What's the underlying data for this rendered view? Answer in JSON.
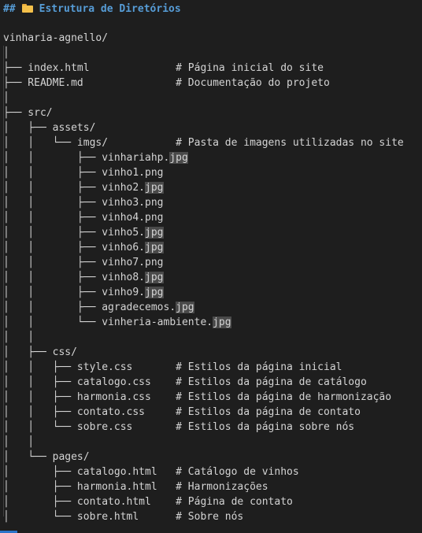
{
  "heading": {
    "hashes": "##",
    "icon": "folder-icon",
    "title": "Estrutura de Diretórios"
  },
  "lines": [
    "vinharia-agnello/",
    "│",
    "├── index.html              # Página inicial do site",
    "├── README.md               # Documentação do projeto",
    "│",
    "├── src/",
    "│   ├── assets/",
    "│   │   └── imgs/           # Pasta de imagens utilizadas no site",
    "│   │       ├── vinhariahp.",
    "│   │       ├── vinho1.png",
    "│   │       ├── vinho2.",
    "│   │       ├── vinho3.png",
    "│   │       ├── vinho4.png",
    "│   │       ├── vinho5.",
    "│   │       ├── vinho6.",
    "│   │       ├── vinho7.png",
    "│   │       ├── vinho8.",
    "│   │       ├── vinho9.",
    "│   │       ├── agradecemos.",
    "│   │       └── vinheria-ambiente.",
    "│   │",
    "│   ├── css/",
    "│   │   ├── style.css       # Estilos da página inicial",
    "│   │   ├── catalogo.css    # Estilos da página de catálogo",
    "│   │   ├── harmonia.css    # Estilos da página de harmonização",
    "│   │   ├── contato.css     # Estilos da página de contato",
    "│   │   └── sobre.css       # Estilos da página sobre nós",
    "│   │",
    "│   └── pages/",
    "│       ├── catalogo.html   # Catálogo de vinhos",
    "│       ├── harmonia.html   # Harmonizações",
    "│       ├── contato.html    # Página de contato",
    "│       └── sobre.html      # Sobre nós"
  ],
  "jpg_ext": "jpg",
  "colors": {
    "background": "#1e1e1e",
    "text": "#d4d4d4",
    "heading": "#569cd6",
    "folder_icon": "#f4c04a",
    "match_highlight": "#4a4a4a"
  }
}
